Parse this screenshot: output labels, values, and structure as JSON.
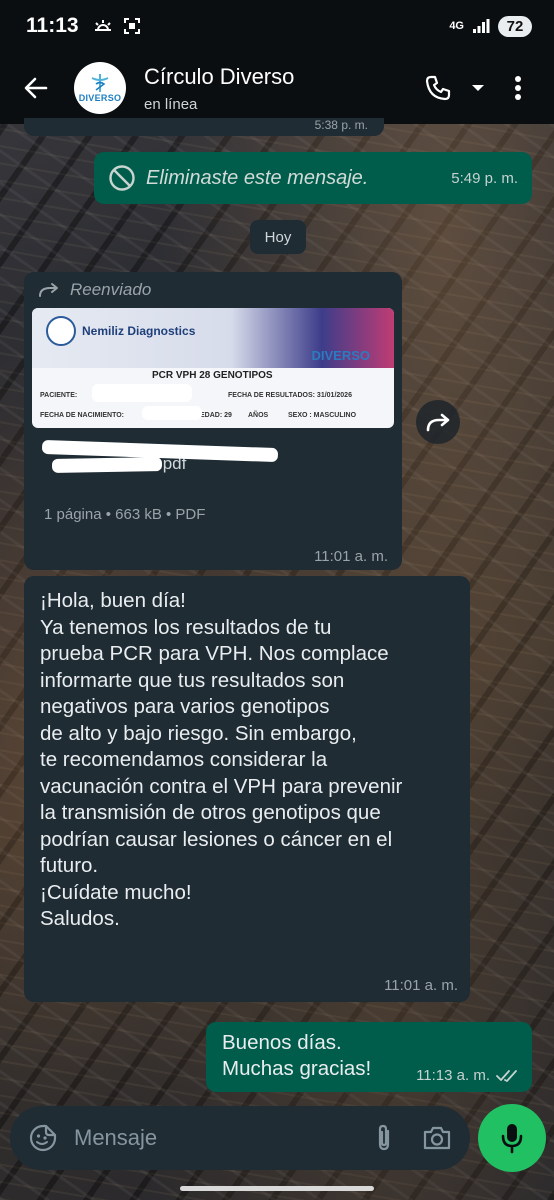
{
  "status_bar": {
    "time": "11:13",
    "network": "4G",
    "battery": "72"
  },
  "header": {
    "contact_name": "Círculo Diverso",
    "status": "en línea",
    "avatar_text": "DIVERSO"
  },
  "messages": {
    "partial_time": "5:38 p. m.",
    "deleted": {
      "text": "Eliminaste este mensaje.",
      "time": "5:49 p. m."
    },
    "date_chip": "Hoy",
    "document": {
      "forwarded_label": "Reenviado",
      "preview_brand": "Nemiliz Diagnostics",
      "preview_logo": "DIVERSO",
      "preview_title": "PCR VPH 28 GENOTIPOS",
      "preview_row1_left": "PACIENTE:",
      "preview_row1_right": "FECHA DE RESULTADOS: 31/01/2026",
      "preview_row2_a": "FECHA DE NACIMIENTO:",
      "preview_row2_b": "EDAD: 29",
      "preview_row2_c": "AÑOS",
      "preview_row2_d": "SEXO : MASCULINO",
      "file_name_suffix": ".pdf",
      "meta": "1 página • 663 kB • PDF",
      "time": "11:01 a. m."
    },
    "incoming_text": {
      "lines": [
        "¡Hola, buen día!",
        "Ya tenemos los resultados de tu",
        "prueba PCR para VPH. Nos complace",
        "informarte que tus resultados son",
        "negativos para varios genotipos",
        "de alto y bajo riesgo. Sin embargo,",
        "te recomendamos considerar la",
        "vacunación contra el VPH para prevenir",
        "la transmisión de otros genotipos que",
        "podrían causar lesiones o cáncer en el",
        "futuro.",
        "¡Cuídate mucho!",
        "Saludos."
      ],
      "time": "11:01 a. m."
    },
    "reply": {
      "line1": "Buenos días.",
      "line2": "Muchas gracias!",
      "time": "11:13 a. m."
    }
  },
  "input": {
    "placeholder": "Mensaje"
  },
  "colors": {
    "outgoing_bubble": "#005c4b",
    "incoming_bubble": "#1f2c34",
    "mic_button": "#21c063",
    "header_bg": "#0b0e10"
  }
}
